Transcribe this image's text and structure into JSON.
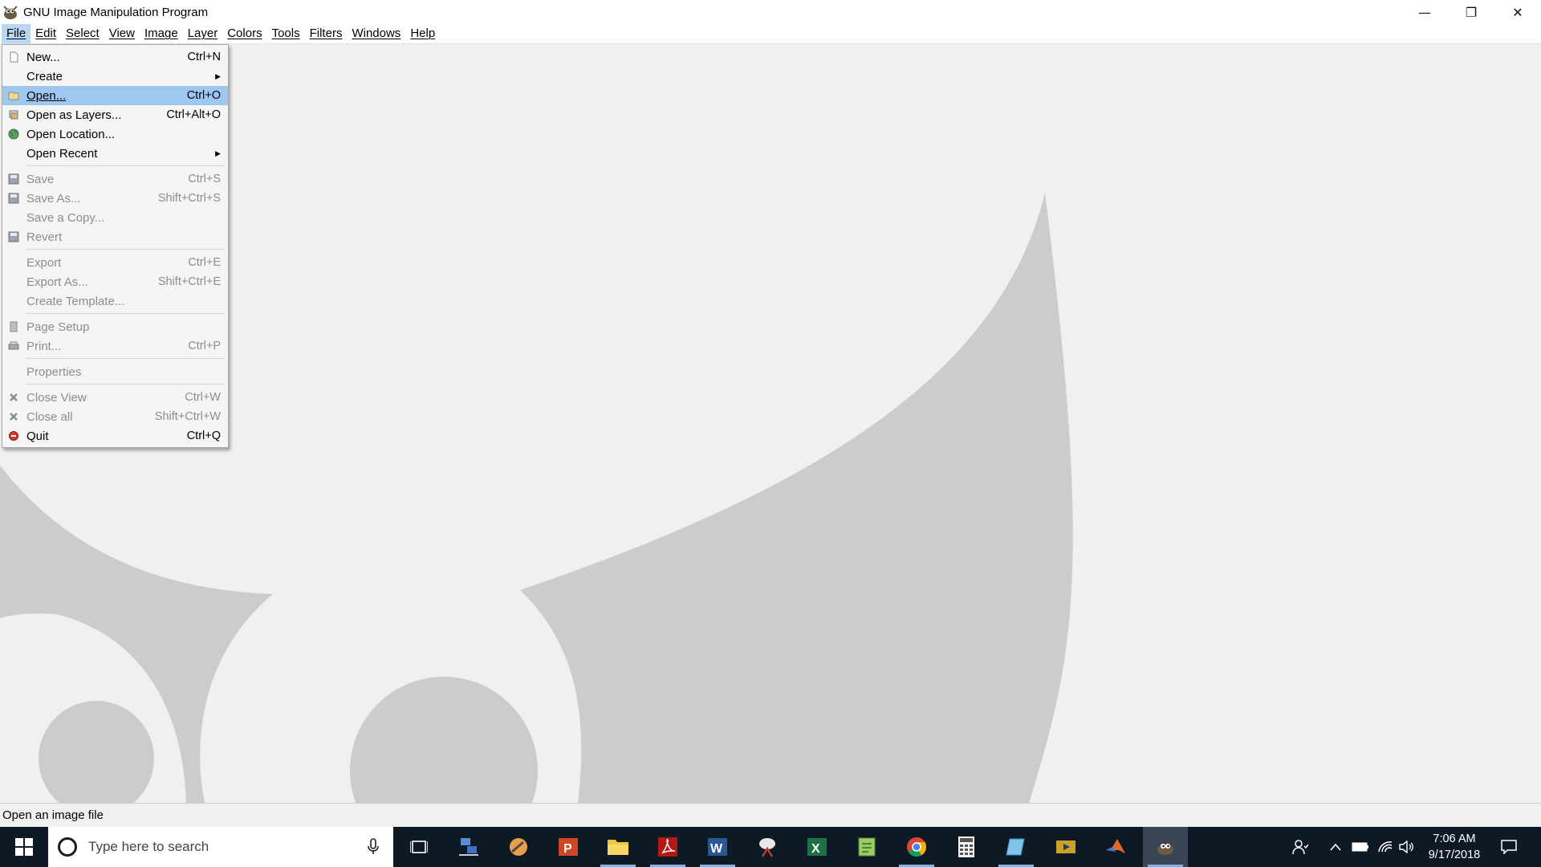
{
  "window": {
    "title": "GNU Image Manipulation Program",
    "controls": {
      "minimize": "—",
      "restore": "❐",
      "close": "✕"
    }
  },
  "menubar": {
    "items": [
      "File",
      "Edit",
      "Select",
      "View",
      "Image",
      "Layer",
      "Colors",
      "Tools",
      "Filters",
      "Windows",
      "Help"
    ],
    "active": "File"
  },
  "file_menu": {
    "items": [
      {
        "label": "New...",
        "shortcut": "Ctrl+N",
        "icon": "new-document-icon",
        "enabled": true
      },
      {
        "label": "Create",
        "shortcut": "",
        "submenu": true,
        "enabled": true
      },
      {
        "label": "Open...",
        "shortcut": "Ctrl+O",
        "icon": "open-folder-icon",
        "enabled": true,
        "highlighted": true
      },
      {
        "label": "Open as Layers...",
        "shortcut": "Ctrl+Alt+O",
        "icon": "open-as-layers-icon",
        "enabled": true
      },
      {
        "label": "Open Location...",
        "shortcut": "",
        "icon": "globe-icon",
        "enabled": true
      },
      {
        "label": "Open Recent",
        "shortcut": "",
        "submenu": true,
        "enabled": true
      },
      {
        "label": "Save",
        "shortcut": "Ctrl+S",
        "icon": "save-icon",
        "enabled": false
      },
      {
        "label": "Save As...",
        "shortcut": "Shift+Ctrl+S",
        "icon": "save-as-icon",
        "enabled": false
      },
      {
        "label": "Save a Copy...",
        "shortcut": "",
        "enabled": false
      },
      {
        "label": "Revert",
        "shortcut": "",
        "icon": "revert-icon",
        "enabled": false
      },
      {
        "label": "Export",
        "shortcut": "Ctrl+E",
        "enabled": false
      },
      {
        "label": "Export As...",
        "shortcut": "Shift+Ctrl+E",
        "enabled": false
      },
      {
        "label": "Create Template...",
        "shortcut": "",
        "enabled": false
      },
      {
        "label": "Page Setup",
        "shortcut": "",
        "icon": "page-setup-icon",
        "enabled": false
      },
      {
        "label": "Print...",
        "shortcut": "Ctrl+P",
        "icon": "print-icon",
        "enabled": false
      },
      {
        "label": "Properties",
        "shortcut": "",
        "enabled": false
      },
      {
        "label": "Close View",
        "shortcut": "Ctrl+W",
        "icon": "close-view-icon",
        "enabled": false
      },
      {
        "label": "Close all",
        "shortcut": "Shift+Ctrl+W",
        "icon": "close-all-icon",
        "enabled": false
      },
      {
        "label": "Quit",
        "shortcut": "Ctrl+Q",
        "icon": "quit-icon",
        "enabled": true
      }
    ]
  },
  "statusbar": {
    "text": "Open an image file"
  },
  "taskbar": {
    "search_placeholder": "Type here to search",
    "apps": [
      "task-view-icon",
      "network-app-icon",
      "paint-app-icon",
      "powerpoint-icon",
      "file-explorer-icon",
      "acrobat-icon",
      "word-icon",
      "snipping-tool-icon",
      "excel-icon",
      "notepad-plus-icon",
      "chrome-icon",
      "calculator-icon",
      "notes-app-icon",
      "media-player-icon",
      "matlab-icon",
      "gimp-icon"
    ],
    "clock": {
      "time": "7:06 AM",
      "date": "9/17/2018"
    }
  },
  "colors": {
    "menu_highlight": "#9ec8ef",
    "menubar_active": "#b8d7f3",
    "wilber_gray": "#cccccc",
    "taskbar": "#0d1a26"
  }
}
